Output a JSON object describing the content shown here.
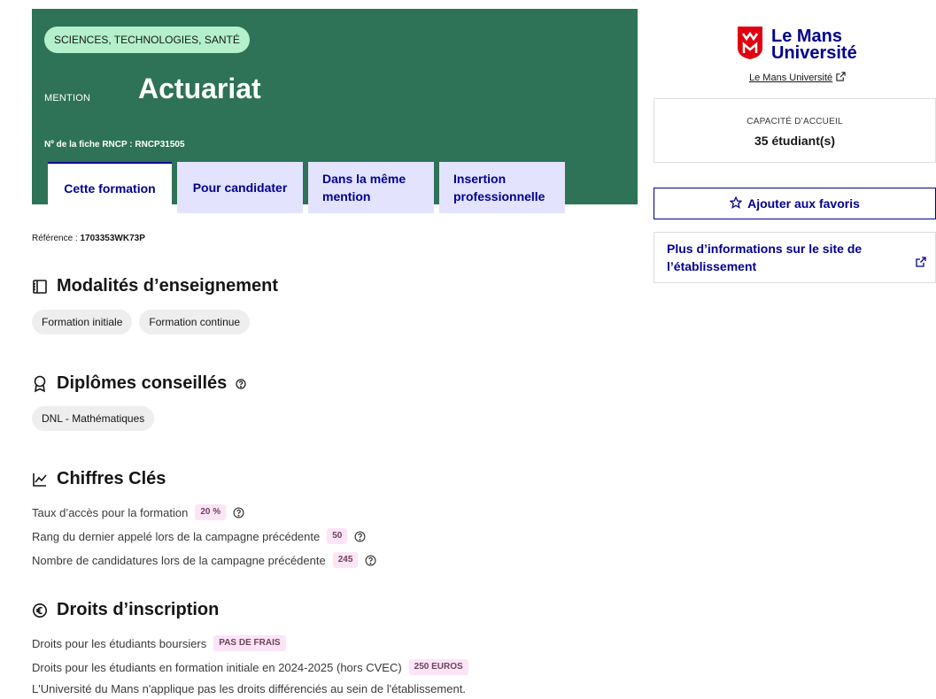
{
  "header": {
    "tag": "SCIENCES, TECHNOLOGIES, SANTÉ",
    "mention_label": "MENTION",
    "title": "Actuariat",
    "rncp": "Nº de la fiche RNCP : RNCP31505",
    "tabs": [
      {
        "label": "Cette formation",
        "active": true
      },
      {
        "label": "Pour candidater",
        "active": false
      },
      {
        "label": "Dans la même mention",
        "active": false
      },
      {
        "label": "Insertion professionnelle",
        "active": false
      }
    ]
  },
  "reference": {
    "label": "Référence :",
    "value": "1703353WK73P"
  },
  "sections": {
    "modalites": {
      "title": "Modalités d’enseignement",
      "icon": "book-icon",
      "chips": [
        "Formation initiale",
        "Formation continue"
      ]
    },
    "diplomes": {
      "title": "Diplômes conseillés",
      "icon": "award-icon",
      "chips": [
        "DNL - Mathématiques"
      ]
    },
    "chiffres": {
      "title": "Chiffres Clés",
      "icon": "line-chart-icon",
      "rows": [
        {
          "label": "Taux d’accès pour la formation",
          "value": "20 %"
        },
        {
          "label": "Rang du dernier appelé lors de la campagne précédente",
          "value": "50"
        },
        {
          "label": "Nombre de candidatures lors de la campagne précédente",
          "value": "245"
        }
      ]
    },
    "droits": {
      "title": "Droits d’inscription",
      "icon": "euro-icon",
      "rows": [
        {
          "label": "Droits pour les étudiants boursiers",
          "value": "PAS DE FRAIS"
        },
        {
          "label": "Droits pour les étudiants en formation initiale en 2024-2025 (hors CVEC)",
          "value": "250 EUROS"
        }
      ],
      "note": "L'Université du Mans n'applique pas les droits différenciés au sein de l'établissement."
    }
  },
  "sidebar": {
    "logo_line1": "Le Mans",
    "logo_line2": "Université",
    "link": "Le Mans Université",
    "capacity_label": "CAPACITÉ D’ACCUEIL",
    "capacity_value": "35 étudiant(s)",
    "favorite_label": "Ajouter aux favoris",
    "more_info": "Plus d’informations sur le site de l’établissement"
  },
  "colors": {
    "hero_bg": "#2e7258",
    "tag_bg": "#b4f0cb",
    "primary": "#000091",
    "tab_bg": "#e3e3fd",
    "badge_bg": "#fde4f7",
    "logo_red": "#e1000f"
  }
}
